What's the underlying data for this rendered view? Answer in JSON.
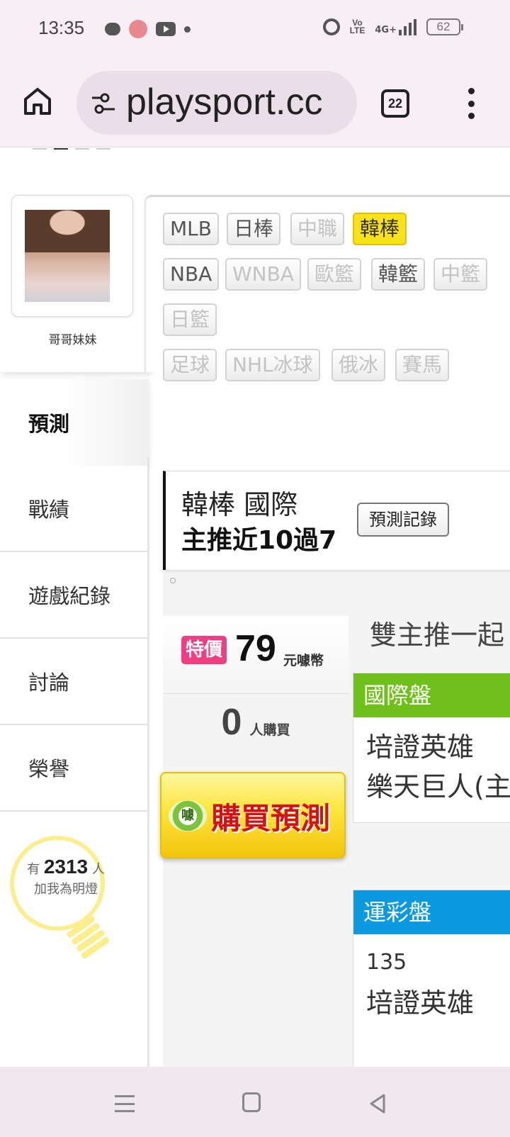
{
  "status_bar": {
    "time": "13:35",
    "volte": "Vo\nLTE",
    "network": "4G+",
    "battery": "62"
  },
  "browser": {
    "url": "playsport.cc",
    "tab_count": "22"
  },
  "profile": {
    "name": "哥哥妹妹"
  },
  "side_menu": [
    {
      "label": "預測",
      "active": true
    },
    {
      "label": "戰績"
    },
    {
      "label": "遊戲紀錄"
    },
    {
      "label": "討論"
    },
    {
      "label": "榮譽"
    }
  ],
  "bulb": {
    "prefix": "有",
    "count": "2313",
    "suffix": "人",
    "line2": "加我為明燈"
  },
  "sports": [
    {
      "label": "MLB",
      "state": "on"
    },
    {
      "label": "日棒",
      "state": "on"
    },
    {
      "label": "中職",
      "state": "off"
    },
    {
      "label": "韓棒",
      "state": "selected"
    },
    {
      "label": "NBA",
      "state": "on"
    },
    {
      "label": "WNBA",
      "state": "off"
    },
    {
      "label": "歐籃",
      "state": "off"
    },
    {
      "label": "韓籃",
      "state": "on"
    },
    {
      "label": "中籃",
      "state": "off"
    },
    {
      "label": "日籃",
      "state": "off"
    },
    {
      "label": "足球",
      "state": "off"
    },
    {
      "label": "NHL冰球",
      "state": "off"
    },
    {
      "label": "俄冰",
      "state": "off"
    },
    {
      "label": "賽馬",
      "state": "off"
    }
  ],
  "prediction": {
    "league": "韓棒 國際",
    "streak": "主推近10過7",
    "record_button": "預測記錄",
    "sale_badge": "特價",
    "price": "79",
    "price_unit": "元噱幣",
    "buyers": "0",
    "buyers_unit": "人購買",
    "buy_button": "購買預測",
    "coin_glyph": "噱",
    "dual_title": "雙主推一起",
    "intl_market": {
      "title": "國際盤",
      "color": "#6fc01a",
      "line1": "培證英雄",
      "line2": "樂天巨人(主"
    },
    "lottery_market": {
      "title": "運彩盤",
      "color": "#0b9ae0",
      "code": "135",
      "line1": "培證英雄"
    }
  }
}
